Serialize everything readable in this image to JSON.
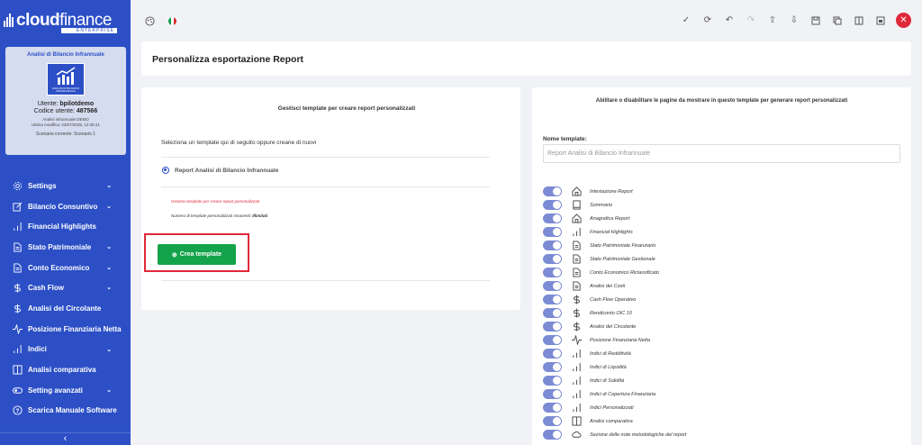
{
  "brand": {
    "name_bold": "cloud",
    "name_light": "finance",
    "edition": "ENTERPRISE"
  },
  "user_card": {
    "title": "Analisi di Bilancio Infrannuale",
    "image_text": "ANALISI DI BILANCIO INFRANNUALE",
    "user_prefix": "Utente: ",
    "user": "bpilotdemo",
    "code_prefix": "Codice utente: ",
    "code": "487566",
    "company": "Analisi infrannuale DEMO",
    "last_mod": "Ultima modifica: 23/07/2025, 12:35:41",
    "scenario": "Scenario corrente: Scenario 1"
  },
  "nav": [
    {
      "label": "Settings",
      "icon": "gear-icon",
      "chevron": true
    },
    {
      "label": "Bilancio Consuntivo",
      "icon": "edit-icon",
      "chevron": true
    },
    {
      "label": "Financial Highlights",
      "icon": "bar-chart-icon",
      "chevron": false
    },
    {
      "label": "Stato Patrimoniale",
      "icon": "document-icon",
      "chevron": true
    },
    {
      "label": "Conto Economico",
      "icon": "document-icon",
      "chevron": true
    },
    {
      "label": "Cash Flow",
      "icon": "dollar-icon",
      "chevron": true
    },
    {
      "label": "Analisi del Circolante",
      "icon": "dollar-icon",
      "chevron": false
    },
    {
      "label": "Posizione Finanziaria Netta",
      "icon": "pulse-icon",
      "chevron": false
    },
    {
      "label": "Indici",
      "icon": "bar-chart-icon",
      "chevron": true
    },
    {
      "label": "Analisi comparativa",
      "icon": "columns-icon",
      "chevron": false
    },
    {
      "label": "Setting avanzati",
      "icon": "toggle-icon",
      "chevron": true
    },
    {
      "label": "Scarica Manuale Software",
      "icon": "help-icon",
      "chevron": false
    }
  ],
  "header": {
    "title": "Personalizza esportazione Report"
  },
  "left_panel": {
    "title": "Gestisci template per creare report personalizzati",
    "subtitle": "Seleziona un template qui di seguito oppure creane di nuovi",
    "selected_template": "Report Analisi di Bilancio Infrannuale",
    "warning": "Gestisci template per creare report personalizzati",
    "remaining_label": "Numero di template personalizzati rimanenti: ",
    "remaining_value": "Illimitati",
    "create_button": "Crea template"
  },
  "right_panel": {
    "title": "Abilitare o disabilitare le pagine da mostrare in questo template per generare report personalizzati",
    "name_label": "Nome template:",
    "name_placeholder": "Report Analisi di Bilancio Infrannuale",
    "pages": [
      {
        "label": "Intestazione Report",
        "icon": "home-icon",
        "enabled": true
      },
      {
        "label": "Sommario",
        "icon": "book-icon",
        "enabled": true
      },
      {
        "label": "Anagrafica Report",
        "icon": "home-icon",
        "enabled": true
      },
      {
        "label": "Financial Highlights",
        "icon": "bar-chart-icon",
        "enabled": true
      },
      {
        "label": "Stato Patrimoniale Finanziario",
        "icon": "document-icon",
        "enabled": true
      },
      {
        "label": "Stato Patrimoniale Gestionale",
        "icon": "document-icon",
        "enabled": true
      },
      {
        "label": "Conto Economico Riclassificato",
        "icon": "document-icon",
        "enabled": true
      },
      {
        "label": "Analisi dei Costi",
        "icon": "document-icon",
        "enabled": true
      },
      {
        "label": "Cash Flow Operativo",
        "icon": "dollar-icon",
        "enabled": true
      },
      {
        "label": "Rendiconto OIC 10",
        "icon": "dollar-icon",
        "enabled": true
      },
      {
        "label": "Analisi del Circolante",
        "icon": "dollar-icon",
        "enabled": true
      },
      {
        "label": "Posizione Finanziaria Netta",
        "icon": "pulse-icon",
        "enabled": true
      },
      {
        "label": "Indici di Redditività",
        "icon": "bar-chart-icon",
        "enabled": true
      },
      {
        "label": "Indici di Liquidità",
        "icon": "bar-chart-icon",
        "enabled": true
      },
      {
        "label": "Indici di Solidità",
        "icon": "bar-chart-icon",
        "enabled": true
      },
      {
        "label": "Indici di Copertura Finanziaria",
        "icon": "bar-chart-icon",
        "enabled": true
      },
      {
        "label": "Indici Personalizzati",
        "icon": "bar-chart-icon",
        "enabled": true
      },
      {
        "label": "Analisi comparativa",
        "icon": "columns-icon",
        "enabled": true
      },
      {
        "label": "Sezione delle note metodologiche del report",
        "icon": "cloud-icon",
        "enabled": true
      }
    ]
  },
  "toolbar": {
    "left": [
      "palette-icon",
      "flag-icon"
    ],
    "right": [
      "check-icon",
      "refresh-icon",
      "undo-icon",
      "redo-icon",
      "upload-icon",
      "download-icon",
      "save-icon",
      "copy-icon",
      "panel-icon",
      "calendar-icon",
      "close-icon"
    ]
  }
}
